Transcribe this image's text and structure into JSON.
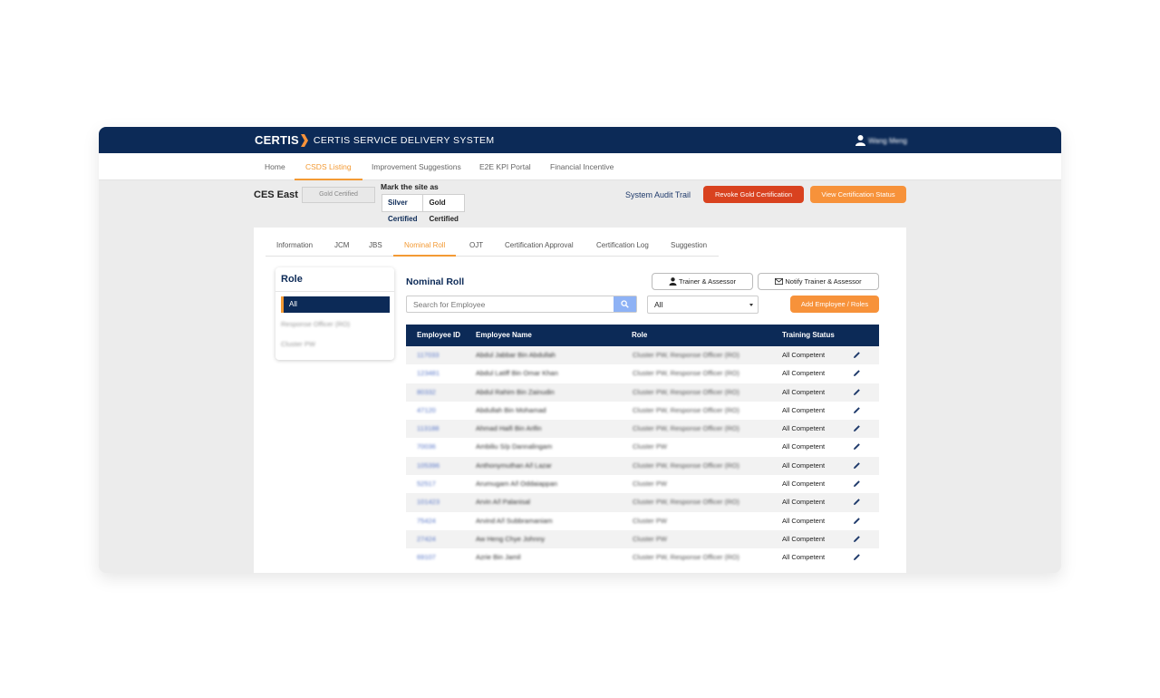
{
  "header": {
    "logo": "CERTIS",
    "system_title": "CERTIS SERVICE DELIVERY SYSTEM",
    "user_name": "Wang Meng"
  },
  "nav": {
    "items": [
      "Home",
      "CSDS Listing",
      "Improvement Suggestions",
      "E2E KPI Portal",
      "Financial Incentive"
    ],
    "active": "CSDS Listing"
  },
  "site": {
    "name": "CES East",
    "certification": "Gold Certified",
    "mark_label": "Mark the site as",
    "mark_options": [
      "Silver Certified",
      "Gold Certified"
    ],
    "audit_link": "System Audit Trail",
    "revoke_button": "Revoke Gold Certification",
    "view_button": "View Certification Status"
  },
  "subtabs": {
    "items": [
      "Information",
      "JCM",
      "JBS",
      "Nominal Roll",
      "OJT",
      "Certification Approval",
      "Certification Log",
      "Suggestion"
    ],
    "active": "Nominal Roll"
  },
  "roles": {
    "title": "Role",
    "items": [
      "All",
      "Response Officer (RO)",
      "Cluster PW"
    ]
  },
  "nominal_roll": {
    "title": "Nominal Roll",
    "trainer_button": "Trainer & Assessor",
    "notify_button": "Notify Trainer & Assessor",
    "search_placeholder": "Search for Employee",
    "filter_value": "All",
    "add_button": "Add Employee / Roles",
    "columns": [
      "Employee ID",
      "Employee Name",
      "Role",
      "Training Status"
    ],
    "rows": [
      {
        "id": "117033",
        "name": "Abdul Jabbar Bin Abdullah",
        "role": "Cluster PW, Response Officer (RO)",
        "status": "All Competent"
      },
      {
        "id": "123481",
        "name": "Abdul Latiff Bin Omar Khan",
        "role": "Cluster PW, Response Officer (RO)",
        "status": "All Competent"
      },
      {
        "id": "80332",
        "name": "Abdul Rahim Bin Zainudin",
        "role": "Cluster PW, Response Officer (RO)",
        "status": "All Competent"
      },
      {
        "id": "47120",
        "name": "Abdullah Bin Mohamad",
        "role": "Cluster PW, Response Officer (RO)",
        "status": "All Competent"
      },
      {
        "id": "113188",
        "name": "Ahmad Haifi Bin Arifin",
        "role": "Cluster PW, Response Officer (RO)",
        "status": "All Competent"
      },
      {
        "id": "70036",
        "name": "Ambiliu S/p Dannalingam",
        "role": "Cluster PW",
        "status": "All Competent"
      },
      {
        "id": "105396",
        "name": "Anthonymuthan A/l Lazar",
        "role": "Cluster PW, Response Officer (RO)",
        "status": "All Competent"
      },
      {
        "id": "52517",
        "name": "Arumugam A/l Oddaiappan",
        "role": "Cluster PW",
        "status": "All Competent"
      },
      {
        "id": "101423",
        "name": "Arvin A/l Palanisal",
        "role": "Cluster PW, Response Officer (RO)",
        "status": "All Competent"
      },
      {
        "id": "75424",
        "name": "Arvind A/l Subbramaniam",
        "role": "Cluster PW",
        "status": "All Competent"
      },
      {
        "id": "27424",
        "name": "Aw Heng Chye Johnny",
        "role": "Cluster PW",
        "status": "All Competent"
      },
      {
        "id": "69107",
        "name": "Azrie Bin Jamil",
        "role": "Cluster PW, Response Officer (RO)",
        "status": "All Competent"
      }
    ]
  },
  "colors": {
    "navy": "#0c2a57",
    "orange": "#f7923a",
    "red": "#d9421f",
    "link": "#5a78c8"
  },
  "icons": {
    "user": "user-icon",
    "search": "search-icon",
    "mail": "mail-icon",
    "edit": "pencil-icon"
  }
}
